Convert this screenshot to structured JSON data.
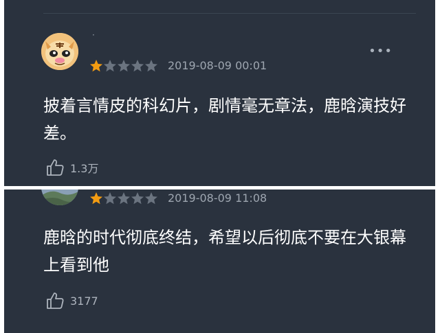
{
  "comments": [
    {
      "username": "·",
      "rating": 1,
      "max_rating": 5,
      "date": "2019-08-09 00:01",
      "text": "披着言情皮的科幻片，剧情毫无章法，鹿晗演技好差。",
      "likes": "1.3万",
      "more_icon": "more-icon",
      "like_icon": "thumbs-up-icon"
    },
    {
      "rating": 1,
      "max_rating": 5,
      "date": "2019-08-09 11:08",
      "text": "鹿晗的时代彻底终结，希望以后彻底不要在大银幕上看到他",
      "likes": "3177",
      "like_icon": "thumbs-up-icon"
    }
  ],
  "colors": {
    "background": "#2a323e",
    "separator": "#ffffff",
    "star_filled": "#f39c12",
    "star_empty": "#6b7480",
    "text": "#ffffff",
    "meta": "#9ea6b0"
  }
}
